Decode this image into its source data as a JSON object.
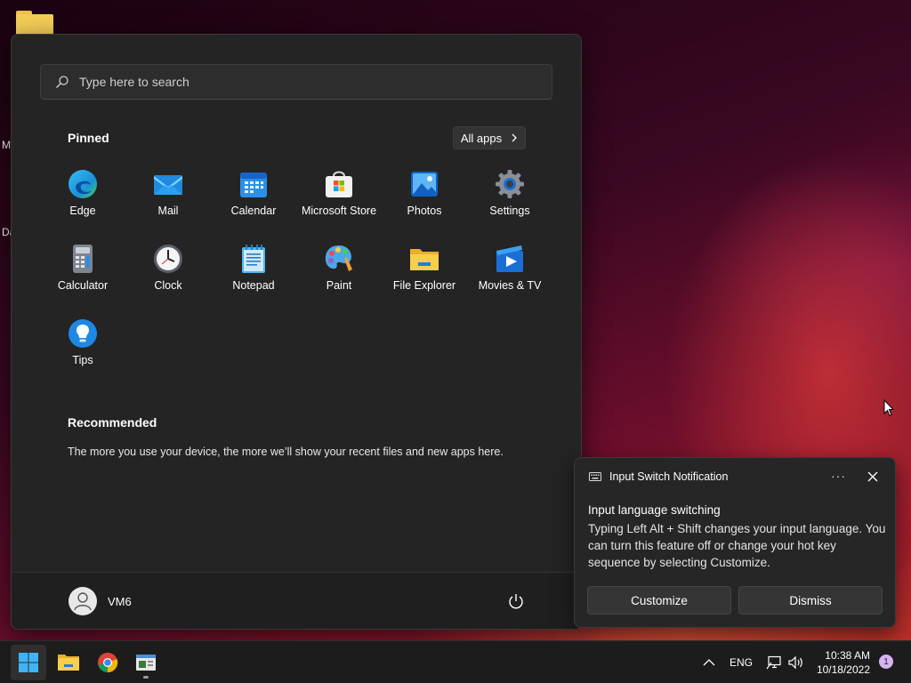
{
  "desktop": {
    "edge_labels": [
      "M",
      "Da"
    ]
  },
  "start_menu": {
    "search": {
      "placeholder": "Type here to search",
      "value": ""
    },
    "pinned_title": "Pinned",
    "all_apps_label": "All apps",
    "pinned_apps": [
      {
        "label": "Edge",
        "icon": "edge-icon"
      },
      {
        "label": "Mail",
        "icon": "mail-icon"
      },
      {
        "label": "Calendar",
        "icon": "calendar-icon"
      },
      {
        "label": "Microsoft Store",
        "icon": "store-icon"
      },
      {
        "label": "Photos",
        "icon": "photos-icon"
      },
      {
        "label": "Settings",
        "icon": "settings-icon"
      },
      {
        "label": "Calculator",
        "icon": "calculator-icon"
      },
      {
        "label": "Clock",
        "icon": "clock-icon"
      },
      {
        "label": "Notepad",
        "icon": "notepad-icon"
      },
      {
        "label": "Paint",
        "icon": "paint-icon"
      },
      {
        "label": "File Explorer",
        "icon": "folder-icon"
      },
      {
        "label": "Movies & TV",
        "icon": "movies-icon"
      },
      {
        "label": "Tips",
        "icon": "tips-icon"
      }
    ],
    "recommended_title": "Recommended",
    "recommended_text": "The more you use your device, the more we’ll show your recent files and new apps here.",
    "user_name": "VM6"
  },
  "notification": {
    "app_name": "Input Switch Notification",
    "more_label": "···",
    "title": "Input language switching",
    "body": "Typing Left Alt + Shift changes your input language. You can turn this feature off or change your hot key sequence by selecting Customize.",
    "primary_button": "Customize",
    "secondary_button": "Dismiss"
  },
  "taskbar": {
    "apps": [
      {
        "name": "start",
        "icon": "windows-icon",
        "active": true
      },
      {
        "name": "file-explorer",
        "icon": "folder-icon",
        "active": false
      },
      {
        "name": "chrome",
        "icon": "chrome-icon",
        "active": false
      },
      {
        "name": "app-window",
        "icon": "window-app-icon",
        "active": false,
        "running": true
      }
    ],
    "tray": {
      "chevron": "^",
      "language": "ENG",
      "time": "10:38 AM",
      "date": "10/18/2022",
      "notification_count": "1"
    }
  },
  "colors": {
    "start_bg": "#242424",
    "taskbar_bg": "#1c1c1c",
    "accent": "#4cc2ff",
    "badge": "#d7b4f0"
  }
}
